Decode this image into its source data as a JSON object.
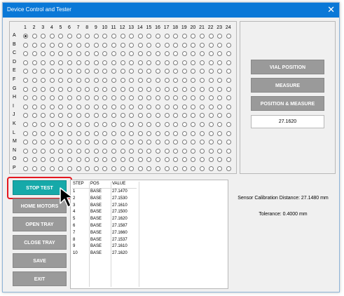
{
  "window": {
    "title": "Device Control and Tester",
    "close_glyph": "✕"
  },
  "grid": {
    "columns": [
      "1",
      "2",
      "3",
      "4",
      "5",
      "6",
      "7",
      "8",
      "9",
      "10",
      "11",
      "12",
      "13",
      "14",
      "15",
      "16",
      "17",
      "18",
      "19",
      "20",
      "21",
      "22",
      "23",
      "24"
    ],
    "rows": [
      "A",
      "B",
      "C",
      "D",
      "E",
      "F",
      "G",
      "H",
      "I",
      "J",
      "K",
      "L",
      "M",
      "N",
      "O",
      "P"
    ],
    "selected": [
      "A-1"
    ]
  },
  "right": {
    "vial_position": "VIAL POSITION",
    "measure": "MEASURE",
    "position_measure": "POSITION & MEASURE",
    "value": "27.1620"
  },
  "left_buttons": {
    "stop_test": "STOP TEST",
    "home_motors": "HOME MOTORS",
    "open_tray": "OPEN TRAY",
    "close_tray": "CLOSE TRAY",
    "save": "SAVE",
    "exit": "EXIT"
  },
  "table": {
    "headers": [
      "STEP",
      "POS",
      "VALUE"
    ],
    "rows": [
      [
        "1",
        "BASE",
        "27.1470"
      ],
      [
        "2",
        "BASE",
        "27.1530"
      ],
      [
        "3",
        "BASE",
        "27.1610"
      ],
      [
        "4",
        "BASE",
        "27.1500"
      ],
      [
        "5",
        "BASE",
        "27.1620"
      ],
      [
        "6",
        "BASE",
        "27.1587"
      ],
      [
        "7",
        "BASE",
        "27.1660"
      ],
      [
        "8",
        "BASE",
        "27.1537"
      ],
      [
        "9",
        "BASE",
        "27.1610"
      ],
      [
        "10",
        "BASE",
        "27.1620"
      ]
    ]
  },
  "info": {
    "calibration": "Sensor Calibration Distance: 27.1480 mm",
    "tolerance": "Tolerance: 0.4000 mm"
  },
  "colors": {
    "titlebar": "#0a78d7",
    "button_gray": "#9a9a9a",
    "stop_teal": "#16a9a9",
    "highlight_red": "#e5171f"
  },
  "icons": {
    "cursor": "mouse-pointer-icon"
  }
}
